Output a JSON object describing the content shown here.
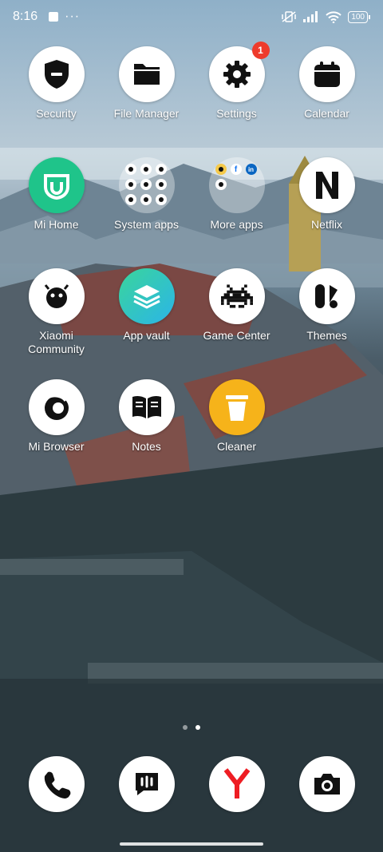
{
  "status_bar": {
    "time": "8:16",
    "battery": "100"
  },
  "apps": [
    {
      "name": "security",
      "label": "Security",
      "icon": "shield-icon"
    },
    {
      "name": "file-manager",
      "label": "File Manager",
      "icon": "folder-icon"
    },
    {
      "name": "settings",
      "label": "Settings",
      "icon": "gear-icon",
      "badge": "1"
    },
    {
      "name": "calendar",
      "label": "Calendar",
      "icon": "calendar-icon"
    },
    {
      "name": "mi-home",
      "label": "Mi Home",
      "icon": "mi-home-icon"
    },
    {
      "name": "system-apps",
      "label": "System apps",
      "icon": "folder-system-apps"
    },
    {
      "name": "more-apps",
      "label": "More apps",
      "icon": "folder-more-apps"
    },
    {
      "name": "netflix",
      "label": "Netflix",
      "icon": "netflix-icon"
    },
    {
      "name": "xiaomi-community",
      "label": "Xiaomi Community",
      "icon": "community-icon"
    },
    {
      "name": "app-vault",
      "label": "App vault",
      "icon": "layers-icon"
    },
    {
      "name": "game-center",
      "label": "Game Center",
      "icon": "space-invader-icon"
    },
    {
      "name": "themes",
      "label": "Themes",
      "icon": "themes-icon"
    },
    {
      "name": "mi-browser",
      "label": "Mi Browser",
      "icon": "browser-icon"
    },
    {
      "name": "notes",
      "label": "Notes",
      "icon": "book-icon"
    },
    {
      "name": "cleaner",
      "label": "Cleaner",
      "icon": "trash-icon"
    }
  ],
  "dock": [
    {
      "name": "phone",
      "icon": "phone-icon"
    },
    {
      "name": "messages",
      "icon": "message-icon"
    },
    {
      "name": "yandex-browser",
      "icon": "yandex-y-icon"
    },
    {
      "name": "camera",
      "icon": "camera-icon"
    }
  ],
  "pages": {
    "count": 2,
    "current": 2
  },
  "colors": {
    "badge": "#ee3b2c",
    "mi_home": "#1fc48a",
    "cleaner": "#f6b31a"
  }
}
